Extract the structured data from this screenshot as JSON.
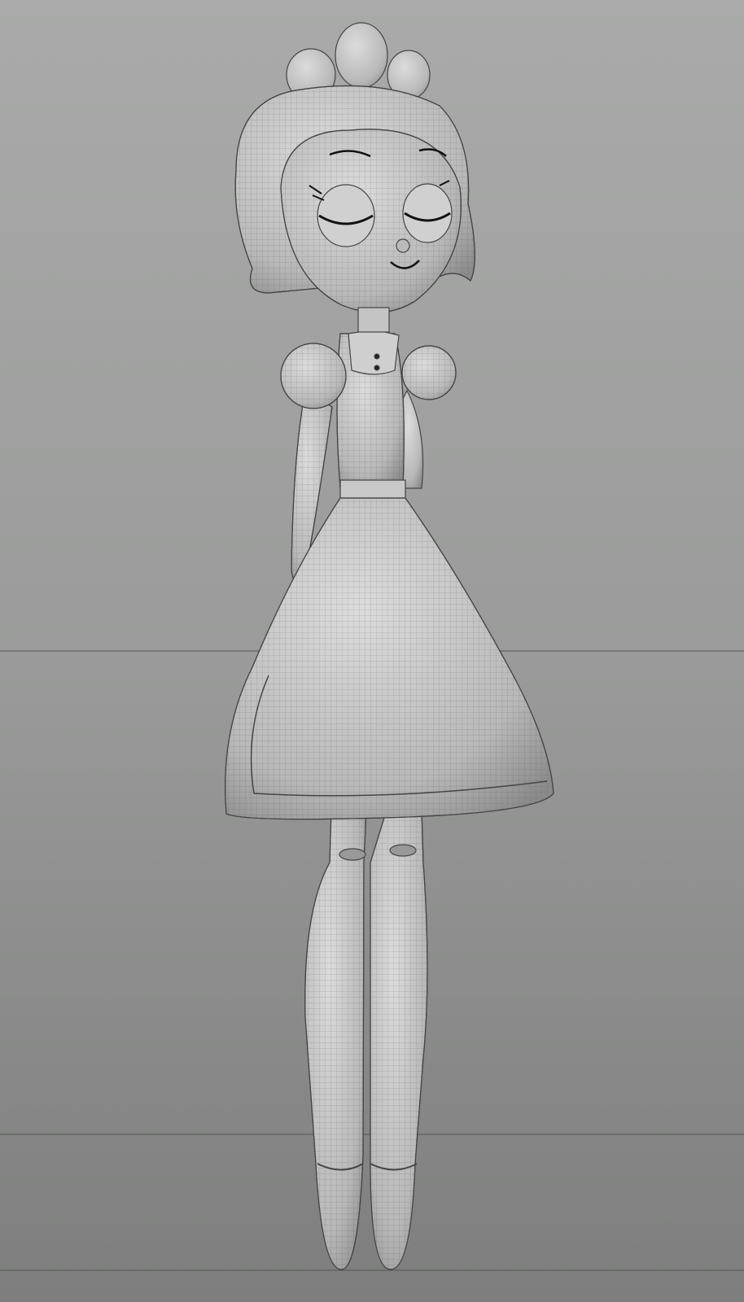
{
  "scene": {
    "colors": {
      "background_top": "#a9aaa9",
      "background_bottom": "#7d7e7d",
      "model_light": "#d4d4d4",
      "model_shadow": "#8e8e8e",
      "wire": "#5a5a5a",
      "ground_line": "#555555"
    }
  }
}
